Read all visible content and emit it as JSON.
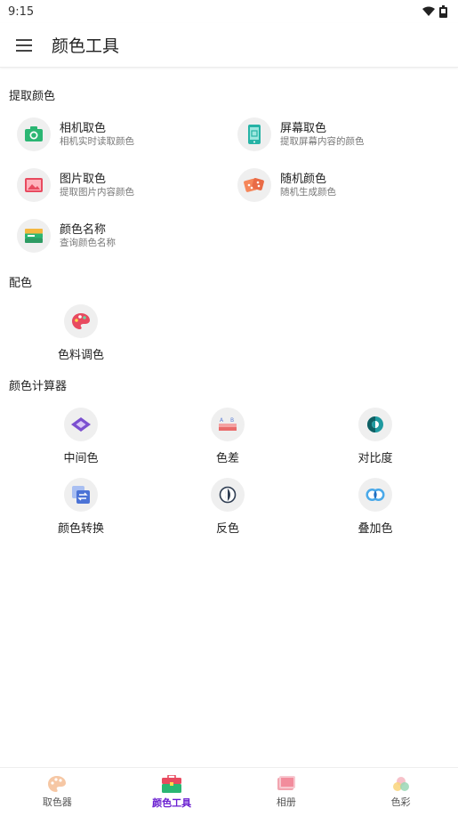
{
  "status_bar": {
    "time": "9:15",
    "icons": [
      "wifi-icon",
      "battery-icon"
    ]
  },
  "app_bar": {
    "menu_icon": "menu-icon",
    "title": "颜色工具"
  },
  "sections": {
    "extract": {
      "title": "提取颜色",
      "items": [
        {
          "title": "相机取色",
          "subtitle": "相机实时读取颜色",
          "icon": "camera-icon"
        },
        {
          "title": "屏幕取色",
          "subtitle": "提取屏幕内容的颜色",
          "icon": "phone-screen-icon"
        },
        {
          "title": "图片取色",
          "subtitle": "提取图片内容颜色",
          "icon": "image-icon"
        },
        {
          "title": "随机颜色",
          "subtitle": "随机生成颜色",
          "icon": "dice-icon"
        },
        {
          "title": "颜色名称",
          "subtitle": "查询颜色名称",
          "icon": "card-icon"
        }
      ]
    },
    "match": {
      "title": "配色",
      "items": [
        {
          "label": "色料调色",
          "icon": "palette-icon"
        }
      ]
    },
    "calc": {
      "title": "颜色计算器",
      "items": [
        {
          "label": "中间色",
          "icon": "diamond-icon"
        },
        {
          "label": "色差",
          "icon": "color-diff-icon"
        },
        {
          "label": "对比度",
          "icon": "contrast-icon"
        },
        {
          "label": "颜色转换",
          "icon": "convert-icon"
        },
        {
          "label": "反色",
          "icon": "invert-icon"
        },
        {
          "label": "叠加色",
          "icon": "overlay-icon"
        }
      ]
    }
  },
  "bottom_nav": {
    "active": "颜色工具",
    "items": [
      {
        "label": "取色器",
        "icon": "palette-nav-icon"
      },
      {
        "label": "颜色工具",
        "icon": "toolbox-icon"
      },
      {
        "label": "相册",
        "icon": "album-icon"
      },
      {
        "label": "色彩",
        "icon": "colors-icon"
      }
    ]
  },
  "colors": {
    "accent": "#6a1fd0",
    "green": "#2bb673",
    "red": "#e84a5f",
    "orange": "#f5865a"
  }
}
